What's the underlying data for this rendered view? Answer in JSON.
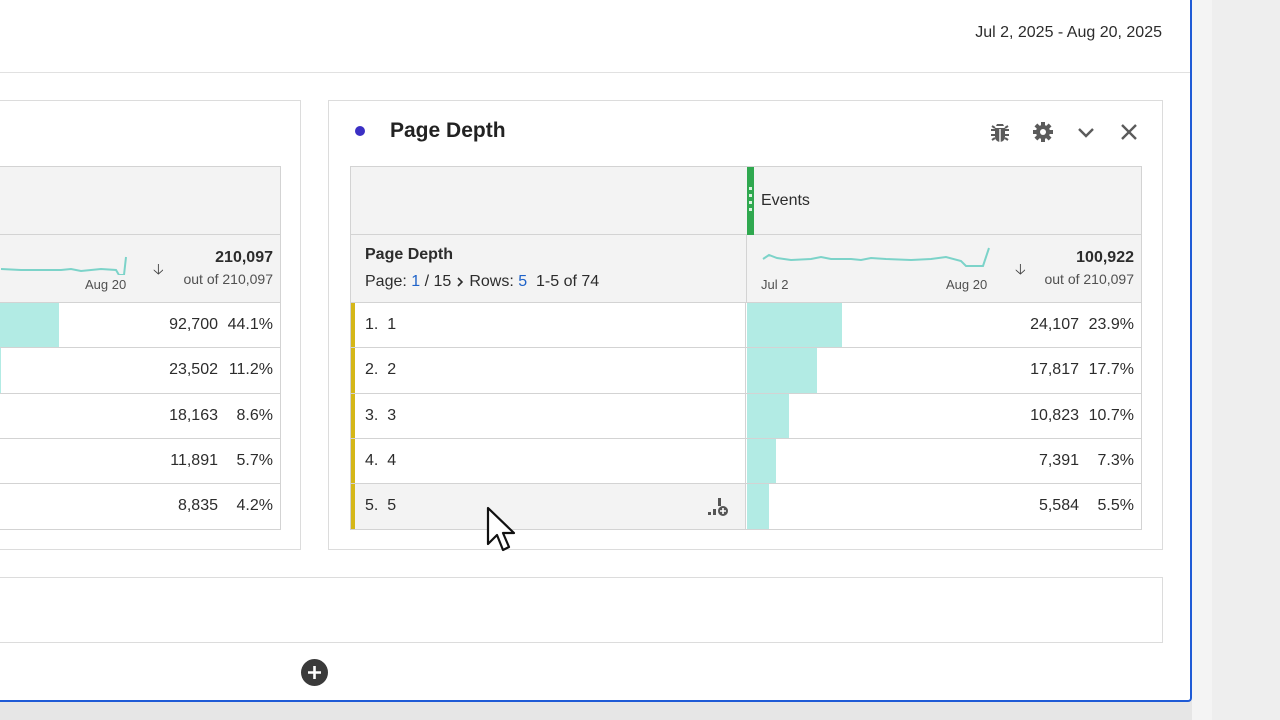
{
  "date_range": "Jul 2, 2025 - Aug 20, 2025",
  "left_panel": {
    "spark_end_label": "Aug 20",
    "total": "210,097",
    "total_of": "out of 210,097",
    "rows": [
      {
        "value": "92,700",
        "pct": "44.1%",
        "bar_fraction": 0.441
      },
      {
        "value": "23,502",
        "pct": "11.2%",
        "bar_fraction": 0.112
      },
      {
        "value": "18,163",
        "pct": "8.6%",
        "bar_fraction": 0.086
      },
      {
        "value": "11,891",
        "pct": "5.7%",
        "bar_fraction": 0.057
      },
      {
        "value": "8,835",
        "pct": "4.2%",
        "bar_fraction": 0.042
      }
    ]
  },
  "panel": {
    "title": "Page Depth",
    "dot_color": "#3b2fc4",
    "actions": [
      "bug-icon",
      "gear-icon",
      "chevron-down-icon",
      "close-icon"
    ],
    "metric_name": "Events",
    "dimension_title": "Page Depth",
    "pager": {
      "page_label": "Page:",
      "page_current": "1",
      "page_total": "/ 15",
      "rows_label": "Rows:",
      "rows_value": "5",
      "range": "1-5 of 74"
    },
    "spark_start_label": "Jul 2",
    "spark_end_label": "Aug 20",
    "total": "100,922",
    "total_of": "out of 210,097",
    "rows": [
      {
        "label": "1.  1",
        "value": "24,107",
        "pct": "23.9%",
        "bar_fraction": 0.239
      },
      {
        "label": "2.  2",
        "value": "17,817",
        "pct": "17.7%",
        "bar_fraction": 0.177
      },
      {
        "label": "3.  3",
        "value": "10,823",
        "pct": "10.7%",
        "bar_fraction": 0.107
      },
      {
        "label": "4.  4",
        "value": "7,391",
        "pct": "7.3%",
        "bar_fraction": 0.073
      },
      {
        "label": "5.  5",
        "value": "5,584",
        "pct": "5.5%",
        "bar_fraction": 0.055
      }
    ]
  },
  "colors": {
    "accent": "#1f5bd6",
    "bar": "#b2ebe4",
    "row_accent": "#d5b719",
    "metric_handle": "#2fa84f",
    "link": "#1f63c9"
  }
}
